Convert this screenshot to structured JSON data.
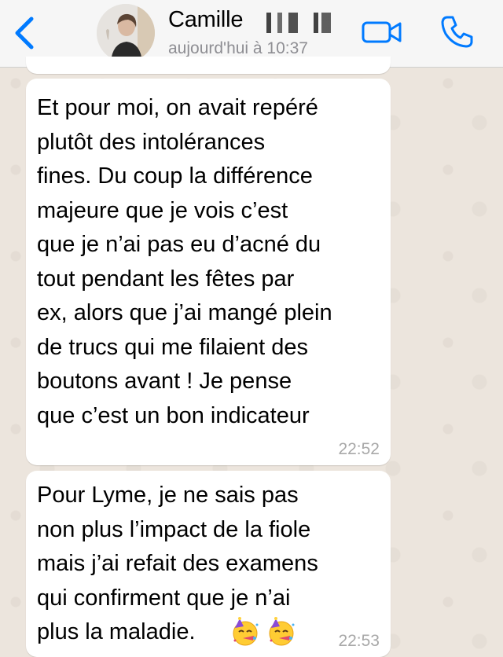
{
  "header": {
    "contact_name": "Camille",
    "last_seen": "aujourd'hui à 10:37",
    "back_icon": "chevron-left-icon",
    "video_icon": "video-camera-icon",
    "call_icon": "phone-icon",
    "accent_color": "#007aff"
  },
  "messages": [
    {
      "text": "Et pour moi, on avait repéré\nplutôt des intolérances\nfines. Du coup la différence\nmajeure que je vois c’est\nque je n’ai pas eu d’acné du\ntout pendant les fêtes par\nex, alors que j’ai mangé plein\nde trucs qui me filaient des\nboutons avant ! Je pense\nque c’est un bon indicateur",
      "time": "22:52"
    },
    {
      "text": "Pour Lyme, je ne sais pas\nnon plus l’impact de la fiole\nmais j’ai refait des examens\nqui confirment que je n’ai\nplus la maladie.",
      "time": "22:53",
      "emojis": [
        "partying-face-emoji",
        "partying-face-emoji"
      ]
    }
  ]
}
